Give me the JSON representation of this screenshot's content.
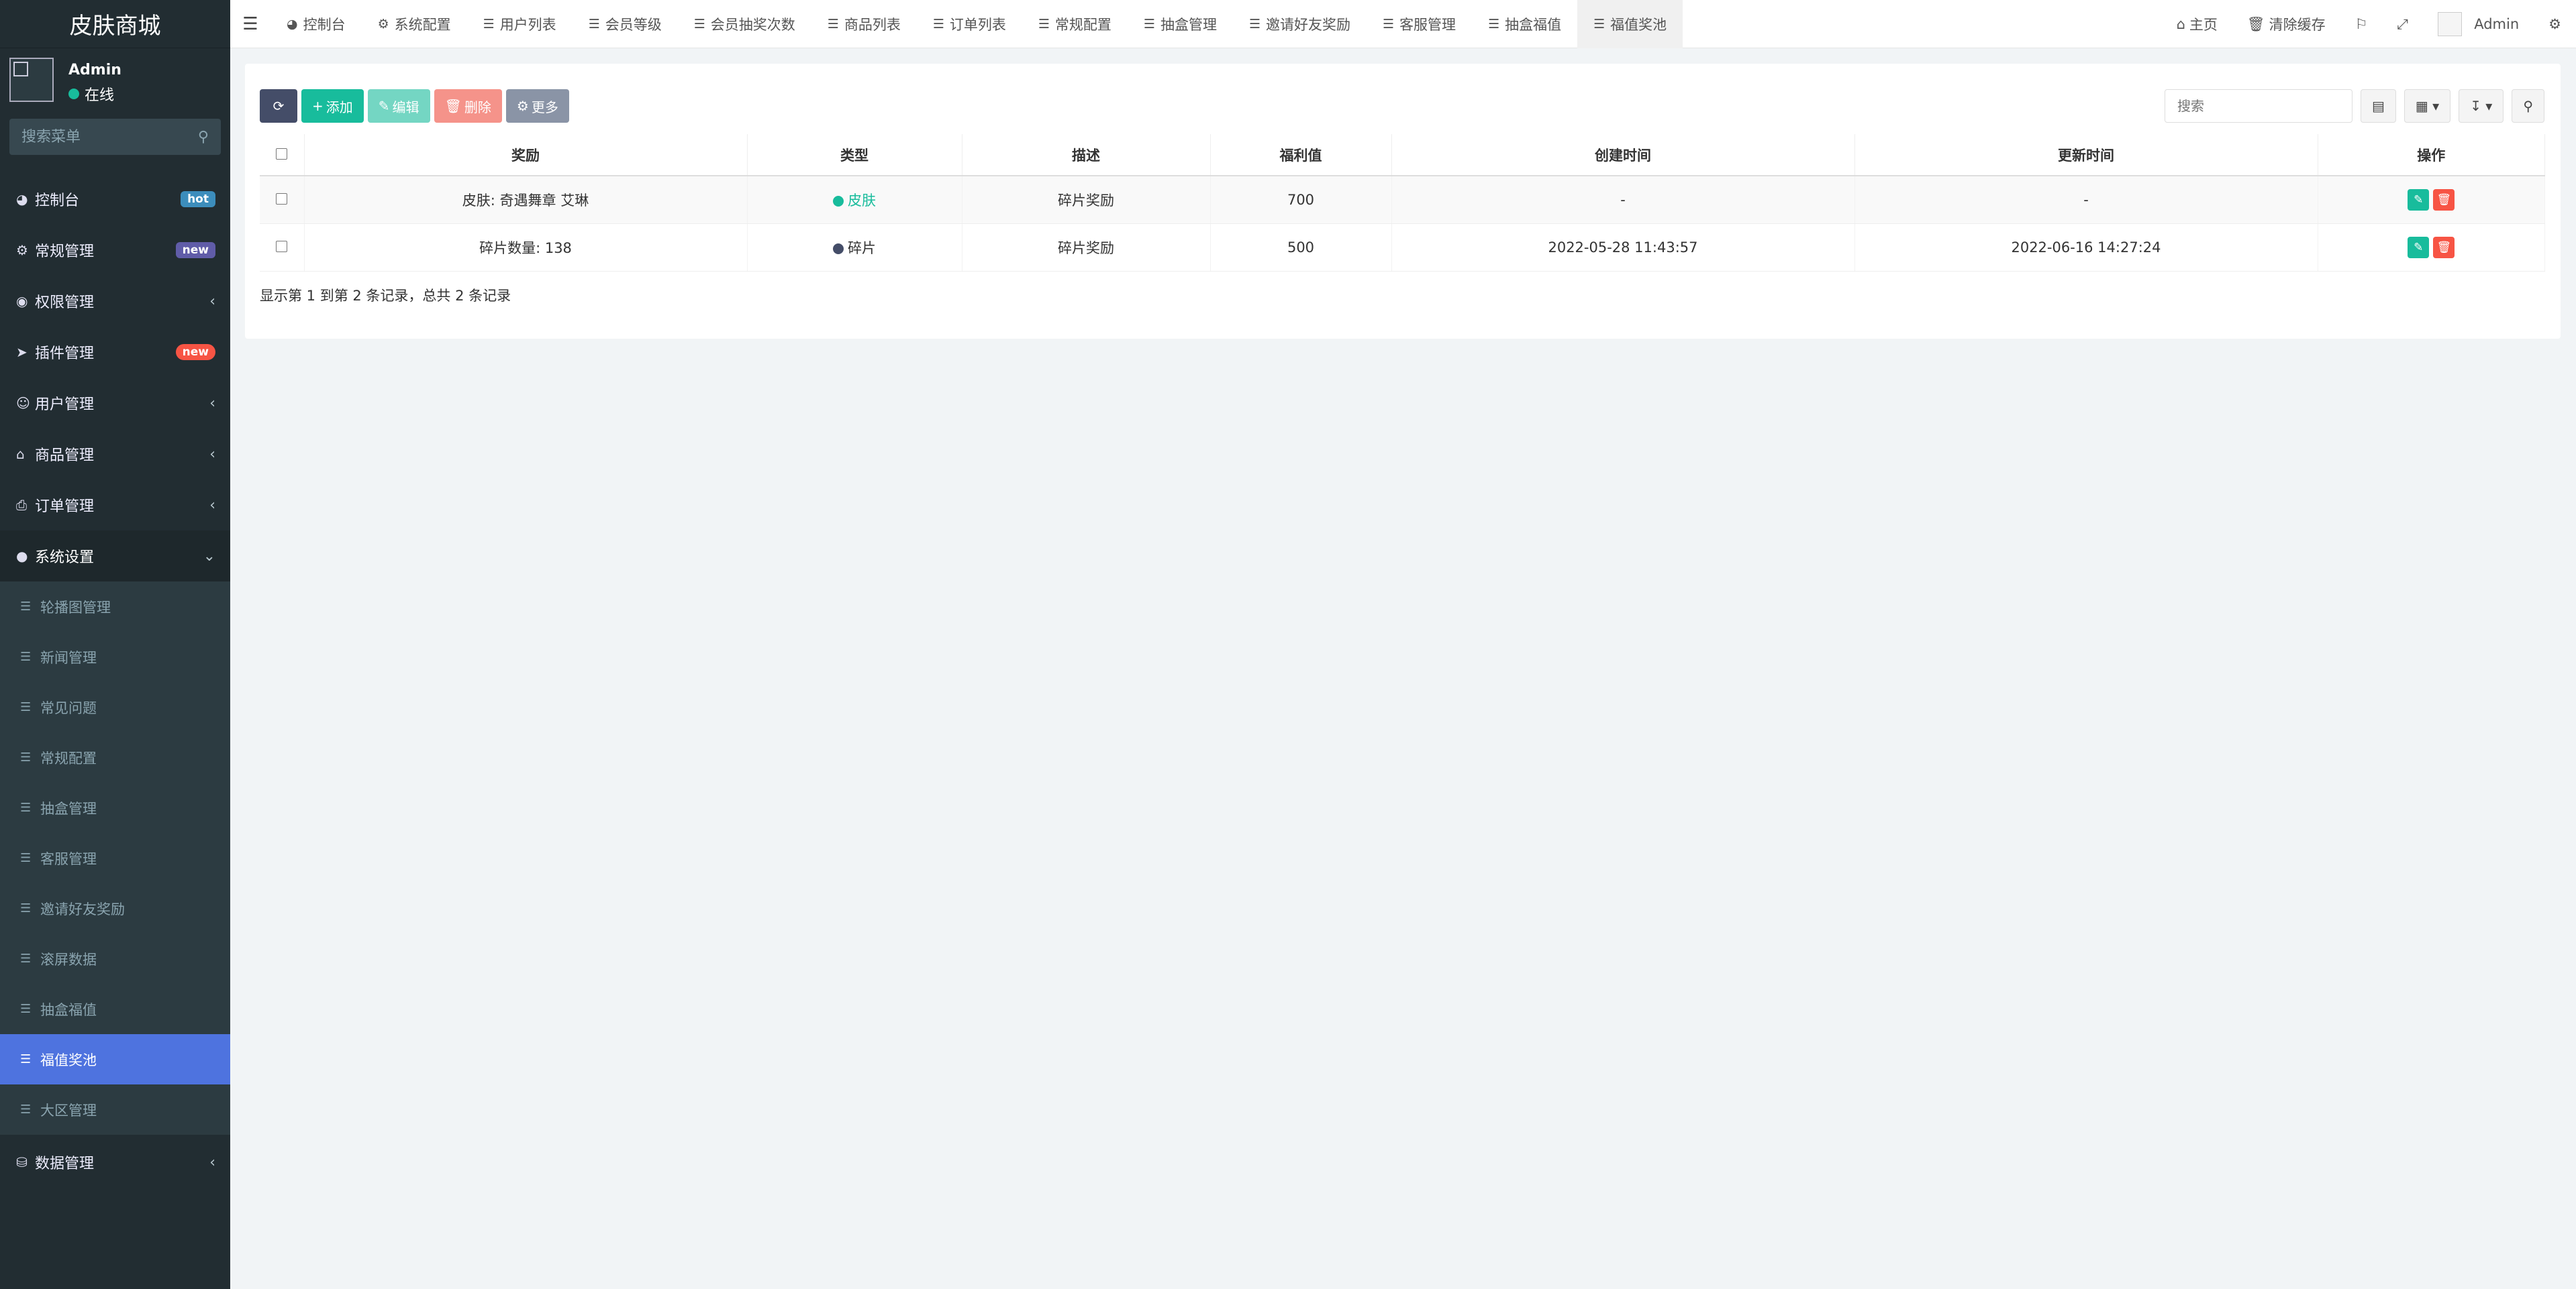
{
  "app": {
    "title": "皮肤商城"
  },
  "user": {
    "name": "Admin",
    "status": "在线"
  },
  "sidebar": {
    "search_placeholder": "搜索菜单",
    "items": [
      {
        "label": "控制台",
        "icon": "dashboard-icon",
        "badge": "hot"
      },
      {
        "label": "常规管理",
        "icon": "cogs-icon",
        "badge": "new"
      },
      {
        "label": "权限管理",
        "icon": "group-icon"
      },
      {
        "label": "插件管理",
        "icon": "rocket-icon",
        "badge": "new"
      },
      {
        "label": "用户管理",
        "icon": "user-icon"
      },
      {
        "label": "商品管理",
        "icon": "shop-icon"
      },
      {
        "label": "订单管理",
        "icon": "print-icon"
      },
      {
        "label": "系统设置",
        "icon": "circle-icon"
      }
    ],
    "submenu": [
      "轮播图管理",
      "新闻管理",
      "常见问题",
      "常规配置",
      "抽盒管理",
      "客服管理",
      "邀请好友奖励",
      "滚屏数据",
      "抽盒福值",
      "福值奖池",
      "大区管理"
    ],
    "last_item": {
      "label": "数据管理",
      "icon": "database-icon"
    }
  },
  "topnav": {
    "tabs": [
      "控制台",
      "系统配置",
      "用户列表",
      "会员等级",
      "会员抽奖次数",
      "商品列表",
      "订单列表",
      "常规配置",
      "抽盒管理",
      "邀请好友奖励",
      "客服管理",
      "抽盒福值",
      "福值奖池"
    ],
    "home": "主页",
    "clear_cache": "清除缓存",
    "admin": "Admin"
  },
  "toolbar": {
    "add": "添加",
    "edit": "编辑",
    "delete": "删除",
    "more": "更多",
    "search_placeholder": "搜索"
  },
  "table": {
    "headers": [
      "奖励",
      "类型",
      "描述",
      "福利值",
      "创建时间",
      "更新时间",
      "操作"
    ],
    "rows": [
      {
        "reward": "皮肤: 奇遇舞章 艾琳",
        "type": "皮肤",
        "type_color": "#18bc9c",
        "desc": "碎片奖励",
        "value": "700",
        "created": "-",
        "updated": "-"
      },
      {
        "reward": "碎片数量: 138",
        "type": "碎片",
        "type_color": "#444d68",
        "desc": "碎片奖励",
        "value": "500",
        "created": "2022-05-28 11:43:57",
        "updated": "2022-06-16 14:27:24"
      }
    ],
    "footer": "显示第 1 到第 2 条记录，总共 2 条记录"
  }
}
